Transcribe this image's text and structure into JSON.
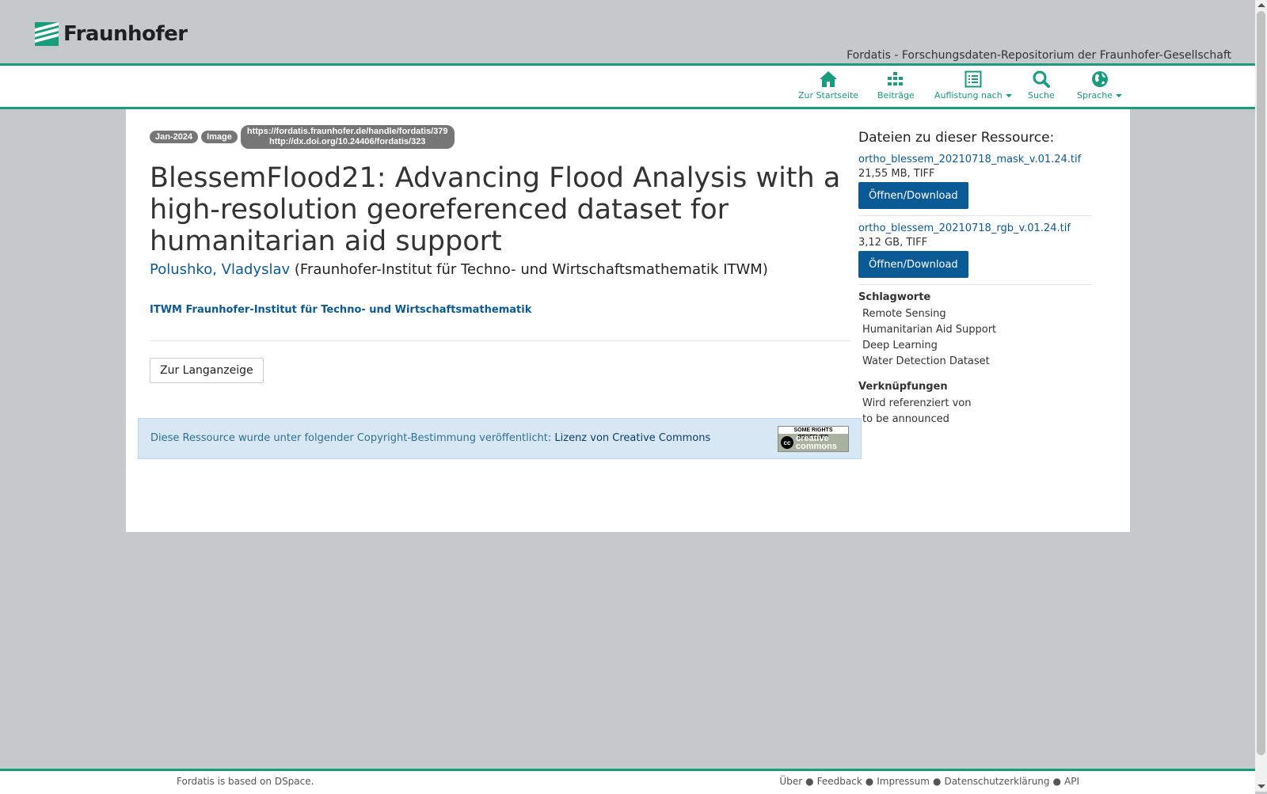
{
  "header": {
    "logo_text": "Fraunhofer",
    "repo_title": "Fordatis - Forschungsdaten-Repositorium der Fraunhofer-Gesellschaft"
  },
  "nav": {
    "home": "Zur Startseite",
    "contributions": "Beiträge",
    "browse": "Auflistung nach",
    "search": "Suche",
    "language": "Sprache"
  },
  "item": {
    "date_badge": "Jan-2024",
    "type_badge": "Image",
    "handle_url": "https://fordatis.fraunhofer.de/handle/fordatis/379",
    "doi_url": "http://dx.doi.org/10.24406/fordatis/323",
    "title": "BlessemFlood21: Advancing Flood Analysis with a high-resolution georeferenced dataset for humanitarian aid support",
    "author": "Polushko, Vladyslav",
    "author_affiliation": "(Fraunhofer-Institut für Techno- und Wirtschaftsmathematik ITWM)",
    "institute": "ITWM Fraunhofer-Institut für Techno- und Wirtschaftsmathematik",
    "long_view_button": "Zur Langanzeige",
    "license_text": "Diese Ressource wurde unter folgender Copyright-Bestimmung veröffentlicht: ",
    "license_link": "Lizenz von Creative Commons",
    "cc_top": "SOME RIGHTS RESERVED",
    "cc_word1": "creative",
    "cc_word2": "commons"
  },
  "sidebar": {
    "files_heading": "Dateien zu dieser Ressource:",
    "files": [
      {
        "name": "ortho_blessem_20210718_mask_v.01.24.tif",
        "meta": "21,55 MB, TIFF",
        "button": "Öffnen/Download"
      },
      {
        "name": "ortho_blessem_20210718_rgb_v.01.24.tif",
        "meta": "3,12 GB, TIFF",
        "button": "Öffnen/Download"
      }
    ],
    "keywords_title": "Schlagworte",
    "keywords": [
      "Remote Sensing",
      "Humanitarian Aid Support",
      "Deep Learning",
      "Water Detection Dataset"
    ],
    "links_title": "Verknüpfungen",
    "links": [
      "Wird referenziert von",
      "to be announced"
    ]
  },
  "footer": {
    "based_on_prefix": "Fordatis is based on ",
    "based_on_link": "DSpace",
    "based_on_suffix": ".",
    "links": [
      "Über",
      "Feedback",
      "Impressum",
      "Datenschutzerklärung",
      "API"
    ]
  },
  "colors": {
    "brand_green": "#179c7d",
    "link_blue": "#0a5a96",
    "background": "#c6c9cc"
  }
}
